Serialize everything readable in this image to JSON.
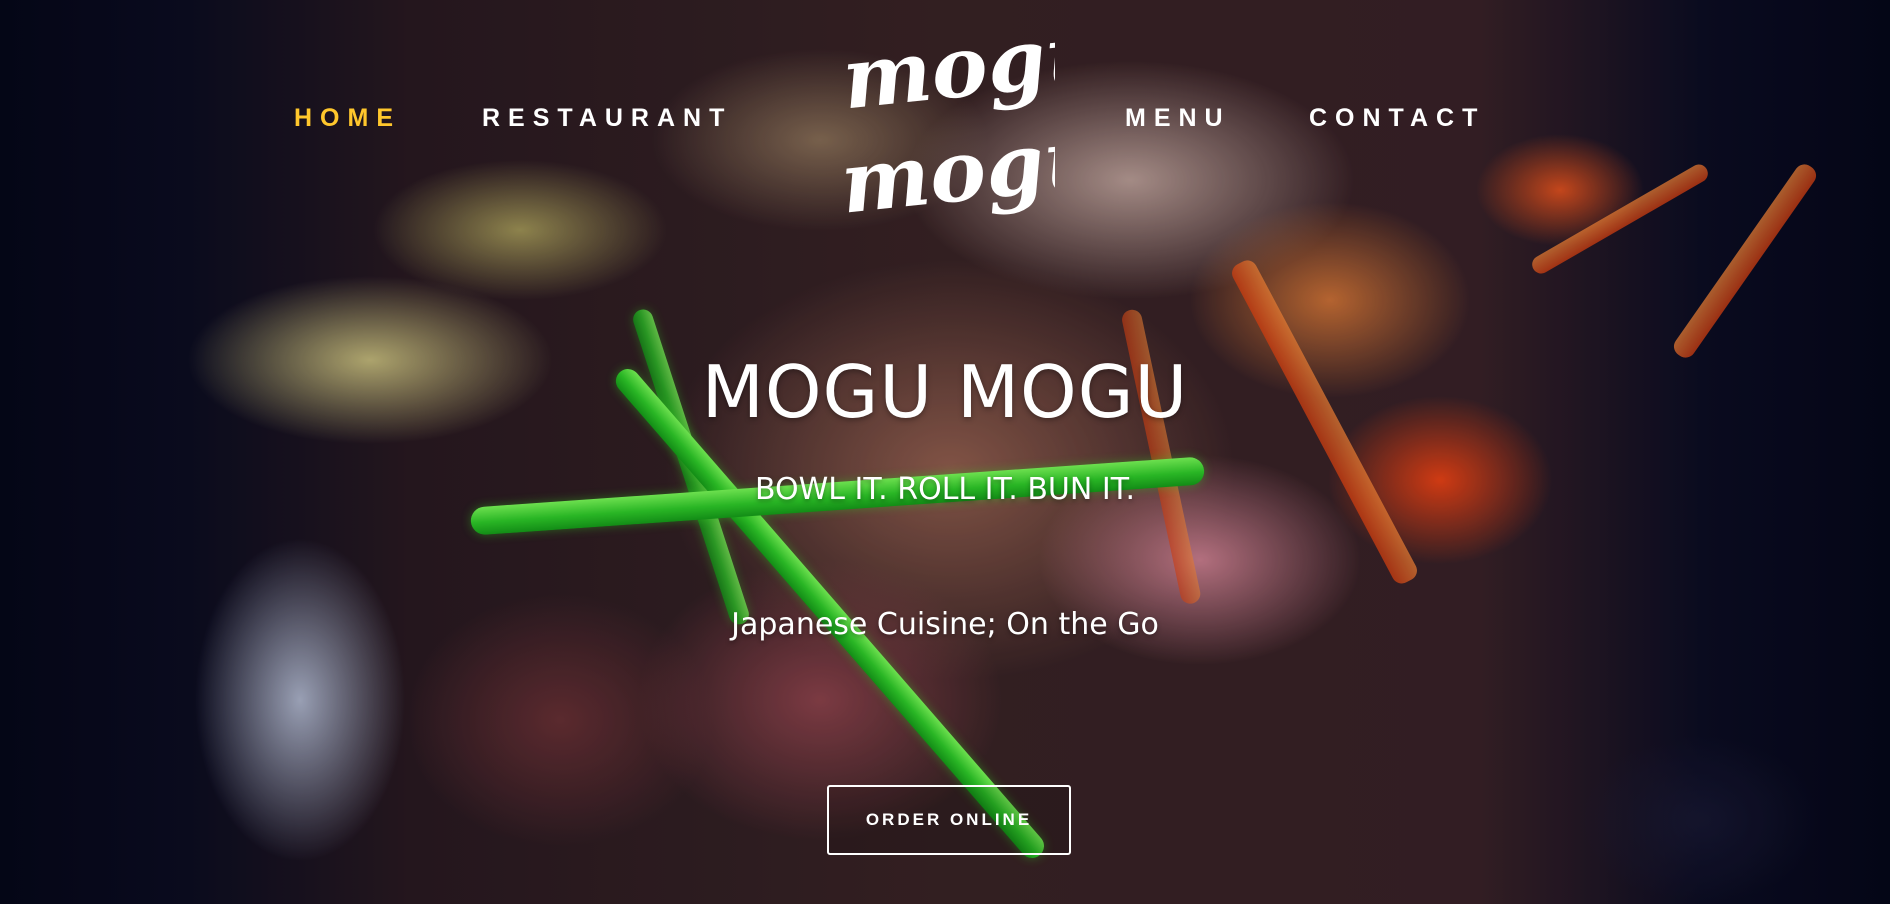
{
  "brand": {
    "logo_text_line1": "mogu",
    "logo_text_line2": "mogu"
  },
  "nav": {
    "items": [
      {
        "label": "HOME",
        "active": true
      },
      {
        "label": "RESTAURANT",
        "active": false
      },
      {
        "label": "MENU",
        "active": false
      },
      {
        "label": "CONTACT",
        "active": false
      }
    ]
  },
  "hero": {
    "title": "MOGU MOGU",
    "tagline": "BOWL IT. ROLL IT. BUN IT.",
    "subtitle": "Japanese Cuisine; On the Go",
    "cta_label": "ORDER ONLINE"
  },
  "colors": {
    "active_nav": "#ffc72c",
    "text": "#ffffff"
  }
}
